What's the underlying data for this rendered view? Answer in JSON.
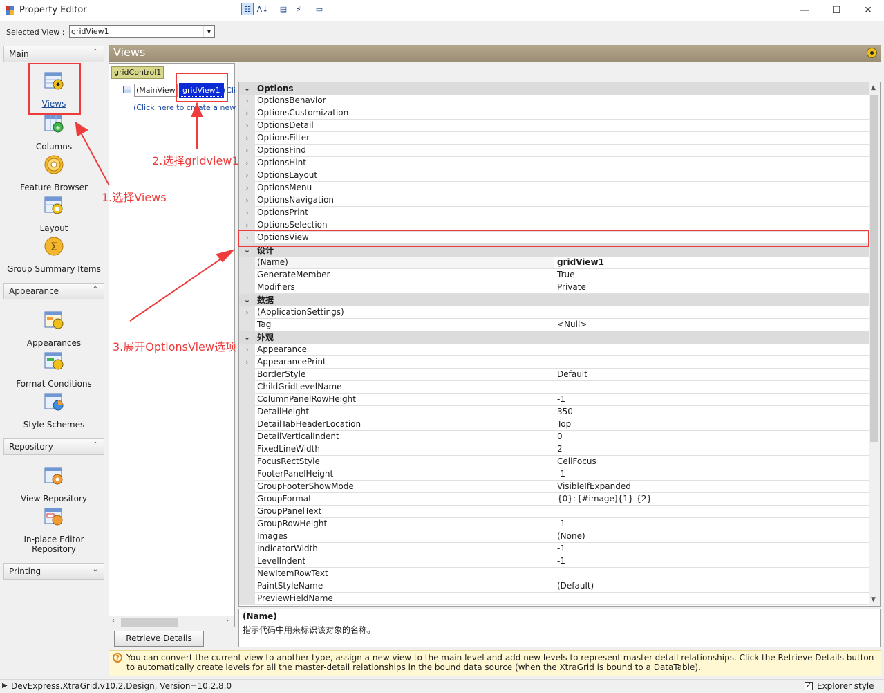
{
  "window": {
    "title": "Property Editor",
    "minimize": "—",
    "maximize": "☐",
    "close": "✕"
  },
  "selected_view": {
    "label": "Selected View :",
    "value": "gridView1"
  },
  "nav": {
    "groups": [
      {
        "label": "Main"
      },
      {
        "label": "Appearance"
      },
      {
        "label": "Repository"
      },
      {
        "label": "Printing"
      }
    ],
    "main_items": [
      "Views",
      "Columns",
      "Feature Browser",
      "Layout",
      "Group Summary Items"
    ],
    "appearance_items": [
      "Appearances",
      "Format Conditions",
      "Style Schemes"
    ],
    "repository_items": [
      "View Repository",
      "In-place Editor Repository"
    ],
    "chevron_up": "⌃",
    "chevron_down": "⌄"
  },
  "views_header": {
    "title": "Views"
  },
  "tree": {
    "root": "gridControl1",
    "main_view": "(MainView",
    "grid_view": "gridView1",
    "cli": "(Cli",
    "create": "(Click here to create a new"
  },
  "retrieve_button": "Retrieve Details",
  "property_grid": {
    "rows": [
      {
        "type": "cat",
        "name": "Options",
        "expander": "⌄"
      },
      {
        "name": "OptionsBehavior",
        "value": "",
        "expander": "›"
      },
      {
        "name": "OptionsCustomization",
        "value": "",
        "expander": "›"
      },
      {
        "name": "OptionsDetail",
        "value": "",
        "expander": "›"
      },
      {
        "name": "OptionsFilter",
        "value": "",
        "expander": "›"
      },
      {
        "name": "OptionsFind",
        "value": "",
        "expander": "›"
      },
      {
        "name": "OptionsHint",
        "value": "",
        "expander": "›"
      },
      {
        "name": "OptionsLayout",
        "value": "",
        "expander": "›"
      },
      {
        "name": "OptionsMenu",
        "value": "",
        "expander": "›"
      },
      {
        "name": "OptionsNavigation",
        "value": "",
        "expander": "›"
      },
      {
        "name": "OptionsPrint",
        "value": "",
        "expander": "›"
      },
      {
        "name": "OptionsSelection",
        "value": "",
        "expander": "›"
      },
      {
        "name": "OptionsView",
        "value": "",
        "expander": "›"
      },
      {
        "type": "cat",
        "name": "设计",
        "expander": "⌄"
      },
      {
        "name": "(Name)",
        "value": "gridView1",
        "selected": true
      },
      {
        "name": "GenerateMember",
        "value": "True"
      },
      {
        "name": "Modifiers",
        "value": "Private"
      },
      {
        "type": "cat",
        "name": "数据",
        "expander": "⌄"
      },
      {
        "name": "(ApplicationSettings)",
        "value": "",
        "expander": "›"
      },
      {
        "name": "Tag",
        "value": "<Null>"
      },
      {
        "type": "cat",
        "name": "外观",
        "expander": "⌄"
      },
      {
        "name": "Appearance",
        "value": "",
        "expander": "›"
      },
      {
        "name": "AppearancePrint",
        "value": "",
        "expander": "›"
      },
      {
        "name": "BorderStyle",
        "value": "Default"
      },
      {
        "name": "ChildGridLevelName",
        "value": ""
      },
      {
        "name": "ColumnPanelRowHeight",
        "value": "-1"
      },
      {
        "name": "DetailHeight",
        "value": "350"
      },
      {
        "name": "DetailTabHeaderLocation",
        "value": "Top"
      },
      {
        "name": "DetailVerticalIndent",
        "value": "0"
      },
      {
        "name": "FixedLineWidth",
        "value": "2"
      },
      {
        "name": "FocusRectStyle",
        "value": "CellFocus"
      },
      {
        "name": "FooterPanelHeight",
        "value": "-1"
      },
      {
        "name": "GroupFooterShowMode",
        "value": "VisibleIfExpanded"
      },
      {
        "name": "GroupFormat",
        "value": "{0}: [#image]{1} {2}"
      },
      {
        "name": "GroupPanelText",
        "value": ""
      },
      {
        "name": "GroupRowHeight",
        "value": "-1"
      },
      {
        "name": "Images",
        "value": "(None)"
      },
      {
        "name": "IndicatorWidth",
        "value": "-1"
      },
      {
        "name": "LevelIndent",
        "value": "-1"
      },
      {
        "name": "NewItemRowText",
        "value": ""
      },
      {
        "name": "PaintStyleName",
        "value": "(Default)"
      },
      {
        "name": "PreviewFieldName",
        "value": ""
      }
    ]
  },
  "description": {
    "title": "(Name)",
    "text": "指示代码中用来标识该对象的名称。"
  },
  "hint": {
    "icon": "?",
    "text": "You can convert the current view to another type, assign a new view to the main level and add new levels to represent master-detail relationships. Click the Retrieve Details button to automatically create levels for all the master-detail relationships in the bound data source (when the XtraGrid is bound to a DataTable)."
  },
  "status": {
    "text": "DevExpress.XtraGrid.v10.2.Design, Version=10.2.8.0",
    "explorer_label": "Explorer style",
    "explorer_checked": "✓"
  },
  "annotations": {
    "step1": "1.选择Views",
    "step2": "2.选择gridview1",
    "step3": "3.展开OptionsView选项"
  },
  "colors": {
    "annotation": "#ee3c3c",
    "header": "#a89b80",
    "selection": "#0a2bd6"
  }
}
